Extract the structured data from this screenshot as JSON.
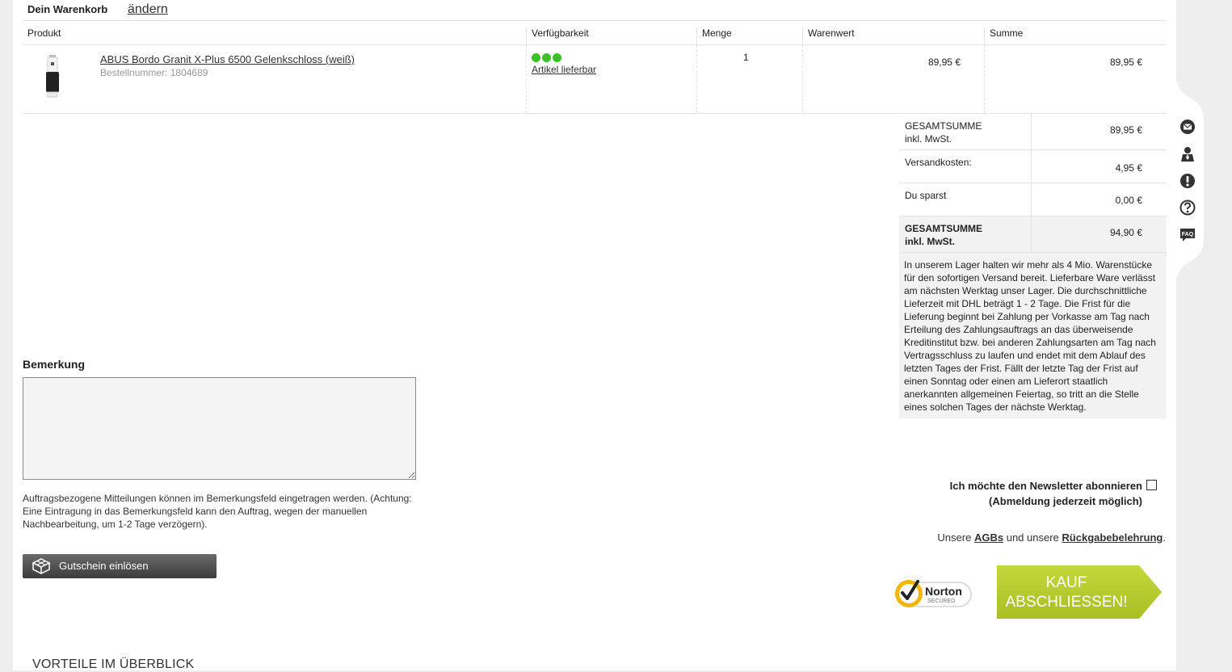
{
  "cart": {
    "heading": "Dein Warenkorb",
    "change_link": "ändern",
    "columns": {
      "product": "Produkt",
      "availability": "Verfügbarkeit",
      "quantity": "Menge",
      "goods_value": "Warenwert",
      "total": "Summe"
    },
    "item": {
      "name": "ABUS Bordo Granit X-Plus 6500 Gelenkschloss (weiß)",
      "order_number": "Bestellnummer: 1804689",
      "availability_text": "Artikel lieferbar",
      "quantity": "1",
      "goods_value": "89,95 €",
      "total": "89,95 €"
    }
  },
  "totals": {
    "subtotal_label_1": "GESAMTSUMME",
    "subtotal_label_2": "inkl. MwSt.",
    "subtotal_value": "89,95 €",
    "shipping_label": "Versandkosten:",
    "shipping_value": "4,95 €",
    "savings_label": "Du sparst",
    "savings_value": "0,00 €",
    "grand_label_1": "GESAMTSUMME",
    "grand_label_2": "inkl. MwSt.",
    "grand_value": "94,90 €"
  },
  "delivery_info": "In unserem Lager halten wir mehr als 4 Mio. Warenstücke für den sofortigen Versand bereit. Lieferbare Ware verlässt am nächsten Werktag unser Lager. Die durchschnittliche Lieferzeit mit DHL beträgt 1 - 2 Tage. Die Frist für die Lieferung beginnt bei Zahlung per Vorkasse am Tag nach Erteilung des Zahlungsauftrags an das überweisende Kreditinstitut bzw. bei anderen Zahlungsarten am Tag nach Vertragsschluss zu laufen und endet mit dem Ablauf des letzten Tages der Frist. Fällt der letzte Tag der Frist auf einen Sonntag oder einen am Lieferort staatlich anerkannten allgemeinen Feiertag, so tritt an die Stelle eines solchen Tages der nächste Werktag.",
  "remark": {
    "title": "Bemerkung",
    "hint": "Auftragsbezogene Mitteilungen können im Bemerkungsfeld eingetragen werden. (Achtung: Eine Eintragung in das Bemerkungsfeld kann den Auftrag, wegen der manuellen Nachbearbeitung, um 1-2 Tage verzögern)."
  },
  "voucher_button": "Gutschein einlösen",
  "newsletter": {
    "line1": "Ich möchte den Newsletter abonnieren",
    "line2": "(Abmeldung jederzeit möglich)"
  },
  "agb": {
    "prefix": "Unsere",
    "agb_link": "AGBs",
    "middle": "und unsere",
    "return_link": "Rückgabebelehrung",
    "suffix": "."
  },
  "norton": {
    "brand": "Norton",
    "tag": "SECURED"
  },
  "buy_button": {
    "line1": "KAUF",
    "line2": "ABSCHLIESSEN!"
  },
  "advantages_heading": "VORTEILE IM ÜBERBLICK",
  "side_icons": [
    "mail-icon",
    "person-icon",
    "alert-icon",
    "help-icon",
    "faq-icon"
  ],
  "faq_icon_text": "FAQ",
  "colors": {
    "availability_green": "#3ec028",
    "buy_button": "#b5cc2e",
    "norton_yellow": "#f2b705"
  }
}
